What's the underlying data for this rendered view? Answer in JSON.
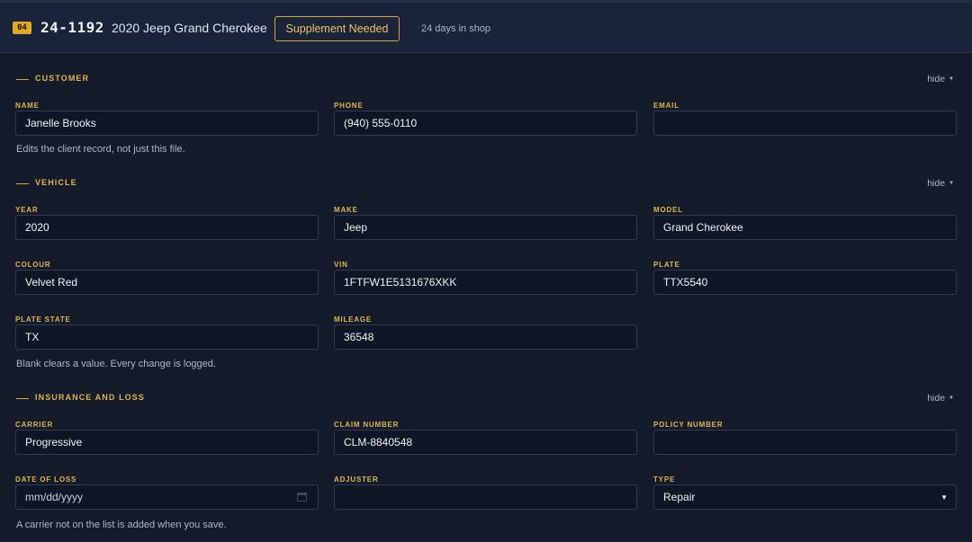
{
  "header": {
    "stage_number": "04",
    "ro_number": "24-1192",
    "vehicle_title": "2020 Jeep Grand Cherokee",
    "status_label": "Supplement Needed",
    "days_in_shop": "24 days in shop"
  },
  "sections": {
    "customer": {
      "title": "CUSTOMER",
      "hide_label": "hide",
      "help_text": "Edits the client record, not just this file.",
      "fields": {
        "name": {
          "label": "NAME",
          "value": "Janelle Brooks"
        },
        "phone": {
          "label": "PHONE",
          "value": "(940) 555-0110"
        },
        "email": {
          "label": "EMAIL",
          "value": ""
        }
      }
    },
    "vehicle": {
      "title": "VEHICLE",
      "hide_label": "hide",
      "help_text": "Blank clears a value. Every change is logged.",
      "fields": {
        "year": {
          "label": "YEAR",
          "value": "2020"
        },
        "make": {
          "label": "MAKE",
          "value": "Jeep"
        },
        "model": {
          "label": "MODEL",
          "value": "Grand Cherokee"
        },
        "colour": {
          "label": "COLOUR",
          "value": "Velvet Red"
        },
        "vin": {
          "label": "VIN",
          "value": "1FTFW1E5131676XKK"
        },
        "plate": {
          "label": "PLATE",
          "value": "TTX5540"
        },
        "plate_state": {
          "label": "PLATE STATE",
          "value": "TX"
        },
        "mileage": {
          "label": "MILEAGE",
          "value": "36548"
        }
      }
    },
    "insurance": {
      "title": "INSURANCE AND LOSS",
      "hide_label": "hide",
      "help_text": "A carrier not on the list is added when you save.",
      "fields": {
        "carrier": {
          "label": "CARRIER",
          "value": "Progressive"
        },
        "claim_number": {
          "label": "CLAIM NUMBER",
          "value": "CLM-8840548"
        },
        "policy_number": {
          "label": "POLICY NUMBER",
          "value": ""
        },
        "date_of_loss": {
          "label": "DATE OF LOSS",
          "placeholder": "mm/dd/yyyy"
        },
        "adjuster": {
          "label": "ADJUSTER",
          "value": ""
        },
        "type": {
          "label": "TYPE",
          "value": "Repair"
        }
      }
    }
  },
  "colors": {
    "accent": "#e0a826",
    "background": "#141c2c",
    "header_bg": "#19243a",
    "input_bg": "#0f1726"
  },
  "icons": {
    "caret": "chevron-down-icon",
    "calendar": "calendar-icon"
  }
}
